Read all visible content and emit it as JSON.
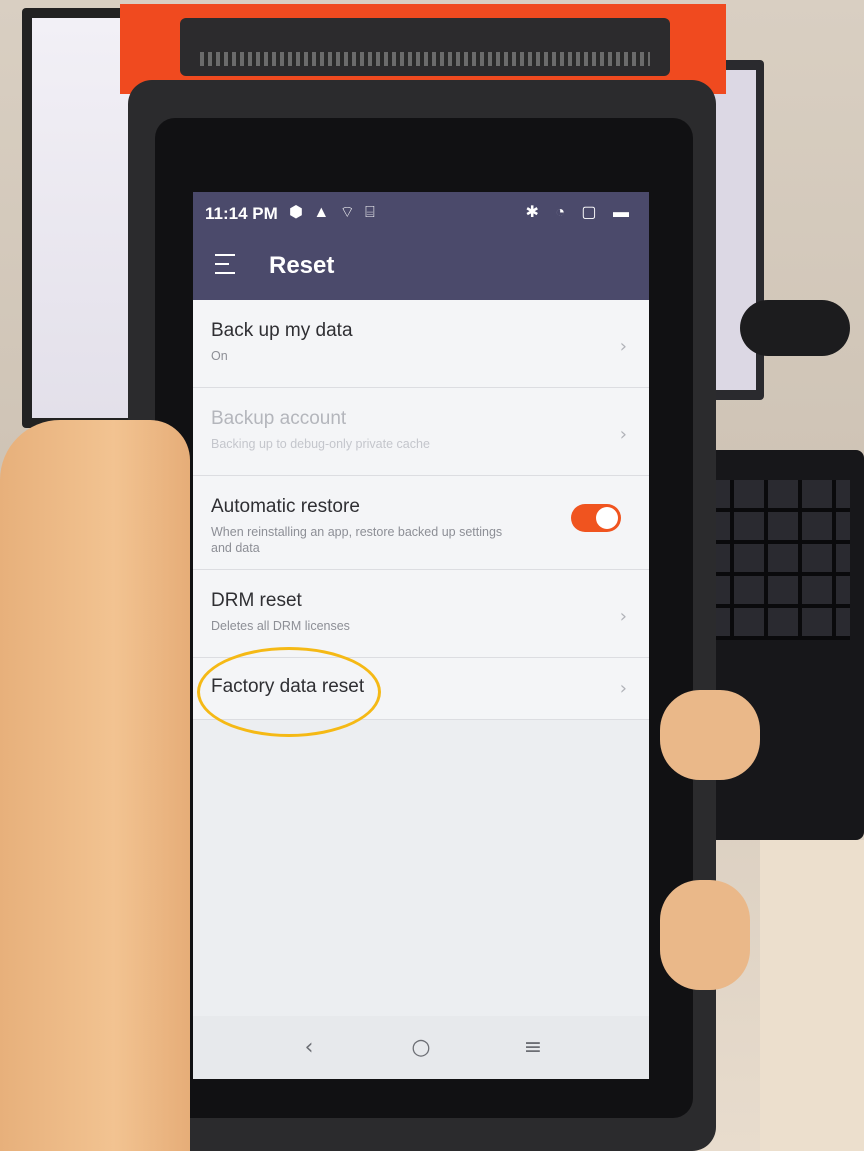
{
  "status_bar": {
    "time": "11:14 PM",
    "left_icons": "⬢ ▲ ⌔ ⌸",
    "right_icons": "✱ ◔ ▢ ▬"
  },
  "app_bar": {
    "title": "Reset"
  },
  "settings": [
    {
      "title": "Back up my data",
      "subtitle": "On",
      "control": "chevron",
      "enabled": true
    },
    {
      "title": "Backup account",
      "subtitle": "Backing up to debug-only private cache",
      "control": "chevron",
      "enabled": false
    },
    {
      "title": "Automatic restore",
      "subtitle": "When reinstalling an app, restore backed up settings and data",
      "control": "toggle",
      "toggle_on": true,
      "enabled": true
    },
    {
      "title": "DRM reset",
      "subtitle": "Deletes all DRM licenses",
      "control": "chevron",
      "enabled": true
    },
    {
      "title": "Factory data reset",
      "subtitle": "",
      "control": "chevron",
      "enabled": true,
      "highlighted": true
    }
  ],
  "chevron_glyph": "›",
  "nav_bar": {
    "back": "‹",
    "home": "○",
    "recents": "≡"
  },
  "colors": {
    "app_bar": "#4b4a6b",
    "toggle_on": "#f0541f",
    "highlight": "#f5b915",
    "device_accent": "#f04a1f"
  },
  "icons": {
    "menu": "hamburger-menu-icon",
    "chevron": "chevron-right-icon",
    "back": "back-icon",
    "home": "home-icon",
    "recents": "recents-icon"
  }
}
